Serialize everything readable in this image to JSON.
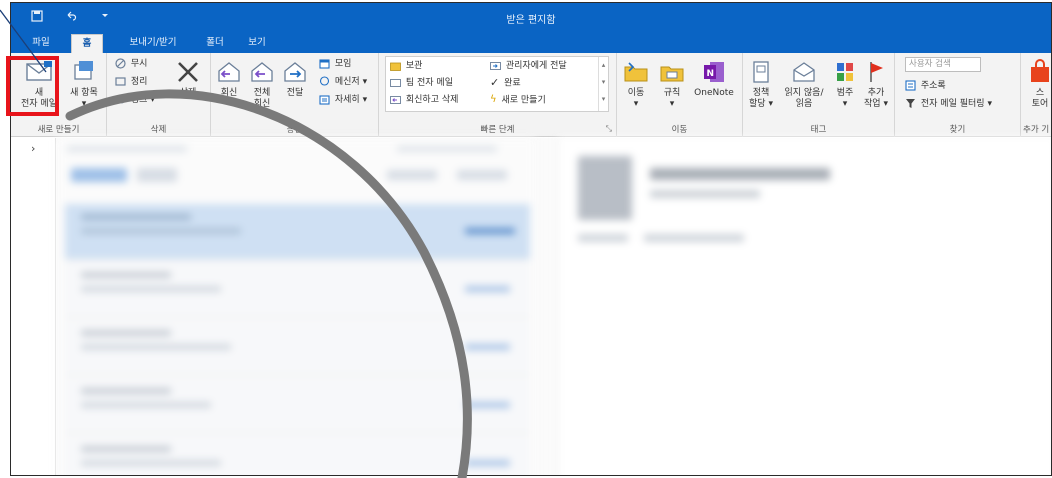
{
  "window": {
    "title": "받은 편지함"
  },
  "tabs": [
    {
      "label": "파일"
    },
    {
      "label": "홈"
    },
    {
      "label": "보내기/받기"
    },
    {
      "label": "폴더"
    },
    {
      "label": "보기"
    }
  ],
  "ribbon": {
    "new": {
      "new_email_line1": "새",
      "new_email_line2": "전자 메일",
      "new_items": "새 항목",
      "label": "새로 만들기"
    },
    "delete": {
      "ignore": "무시",
      "cleanup": "정리",
      "junk": "정크",
      "delete": "삭제",
      "label": "삭제"
    },
    "respond": {
      "reply": "회신",
      "reply_all_line1": "전체",
      "reply_all_line2": "회신",
      "forward": "전달",
      "meeting": "모임",
      "im": "메신저",
      "more": "자세히",
      "label": "응답"
    },
    "quick_steps": {
      "archive": "보관",
      "team_email": "팀 전자 메일",
      "reply_delete": "회신하고 삭제",
      "to_manager": "관리자에게 전달",
      "done": "완료",
      "create_new": "새로 만들기",
      "label": "빠른 단계"
    },
    "move": {
      "move": "이동",
      "rules": "규칙",
      "onenote": "OneNote",
      "label": "이동"
    },
    "tags": {
      "policy_line1": "정책",
      "policy_line2": "할당",
      "unread_line1": "읽지 않음/",
      "unread_line2": "읽음",
      "categorize": "범주",
      "followup_line1": "추가",
      "followup_line2": "작업",
      "label": "태그"
    },
    "find": {
      "search_placeholder": "사용자 검색",
      "address_book": "주소록",
      "filter_email": "전자 메일 필터링",
      "label": "찾기"
    },
    "addins": {
      "store_line1": "스",
      "store_line2": "토어",
      "label": "추가 기"
    }
  },
  "nav": {
    "expand": "›"
  },
  "colors": {
    "accent": "#0a64c4",
    "highlight": "#e8141b",
    "arc": "#7a7a7a"
  }
}
